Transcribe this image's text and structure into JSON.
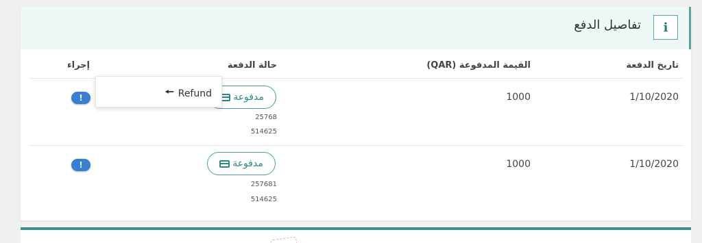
{
  "panel": {
    "title": "تفاصيل الدفع",
    "info_icon": "i"
  },
  "table": {
    "headers": {
      "date": "تاريخ الدفعة",
      "amount": "القيمة المدفوعة (QAR)",
      "status": "حالة الدفعة",
      "action": "إجراء"
    },
    "rows": [
      {
        "date": "1/10/2020",
        "amount": "1000",
        "status": "مدفوعة",
        "ref1": "25768",
        "ref2": "514625",
        "action_icon": "!"
      },
      {
        "date": "1/10/2020",
        "amount": "1000",
        "status": "مدفوعة",
        "ref1": "257681",
        "ref2": "514625",
        "action_icon": "!"
      }
    ]
  },
  "dropdown": {
    "item_label": "Refund",
    "item_icon": "arrow-left-icon"
  },
  "colors": {
    "accent": "#4a9d98",
    "header_bg": "#eef8f6",
    "action_button": "#3a7dd4"
  }
}
